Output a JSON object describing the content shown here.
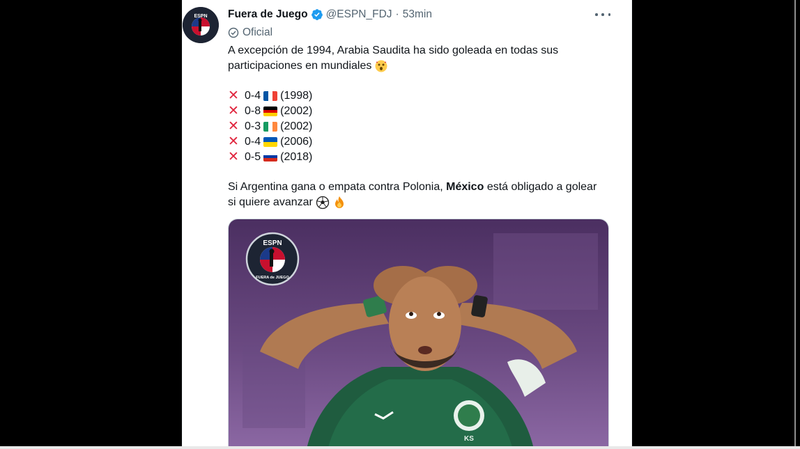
{
  "tweet": {
    "display_name": "Fuera de Juego",
    "handle": "@ESPN_FDJ",
    "separator": "·",
    "time": "53min",
    "label": "Oficial",
    "intro_line1": "A excepción de 1994, Arabia Saudita ha sido goleada en todas sus",
    "intro_line2": "participaciones en mundiales",
    "results": [
      {
        "score": "0-4",
        "year": "(1998)",
        "flag": "france"
      },
      {
        "score": "0-8",
        "year": "(2002)",
        "flag": "germany"
      },
      {
        "score": "0-3",
        "year": "(2002)",
        "flag": "ireland"
      },
      {
        "score": "0-4",
        "year": "(2006)",
        "flag": "ukraine"
      },
      {
        "score": "0-5",
        "year": "(2018)",
        "flag": "russia"
      }
    ],
    "outro_pre": "Si Argentina gana o empata contra Polonia,",
    "outro_bold": "México",
    "outro_post": "está obligado a golear",
    "outro_line2": "si quiere avanzar",
    "media": {
      "logo_top": "ESPN",
      "logo_bottom": "FUERA de JUEGO",
      "shirt_text": "KS"
    }
  },
  "colors": {
    "verified": "#1d9bf0",
    "text": "#0f1419",
    "secondary": "#536471",
    "cross": "#e0243d"
  },
  "icons": [
    "verified-badge-icon",
    "more-icon",
    "official-check-icon",
    "cross-mark-icon",
    "astonished-face-icon",
    "soccer-ball-icon",
    "fire-icon"
  ]
}
